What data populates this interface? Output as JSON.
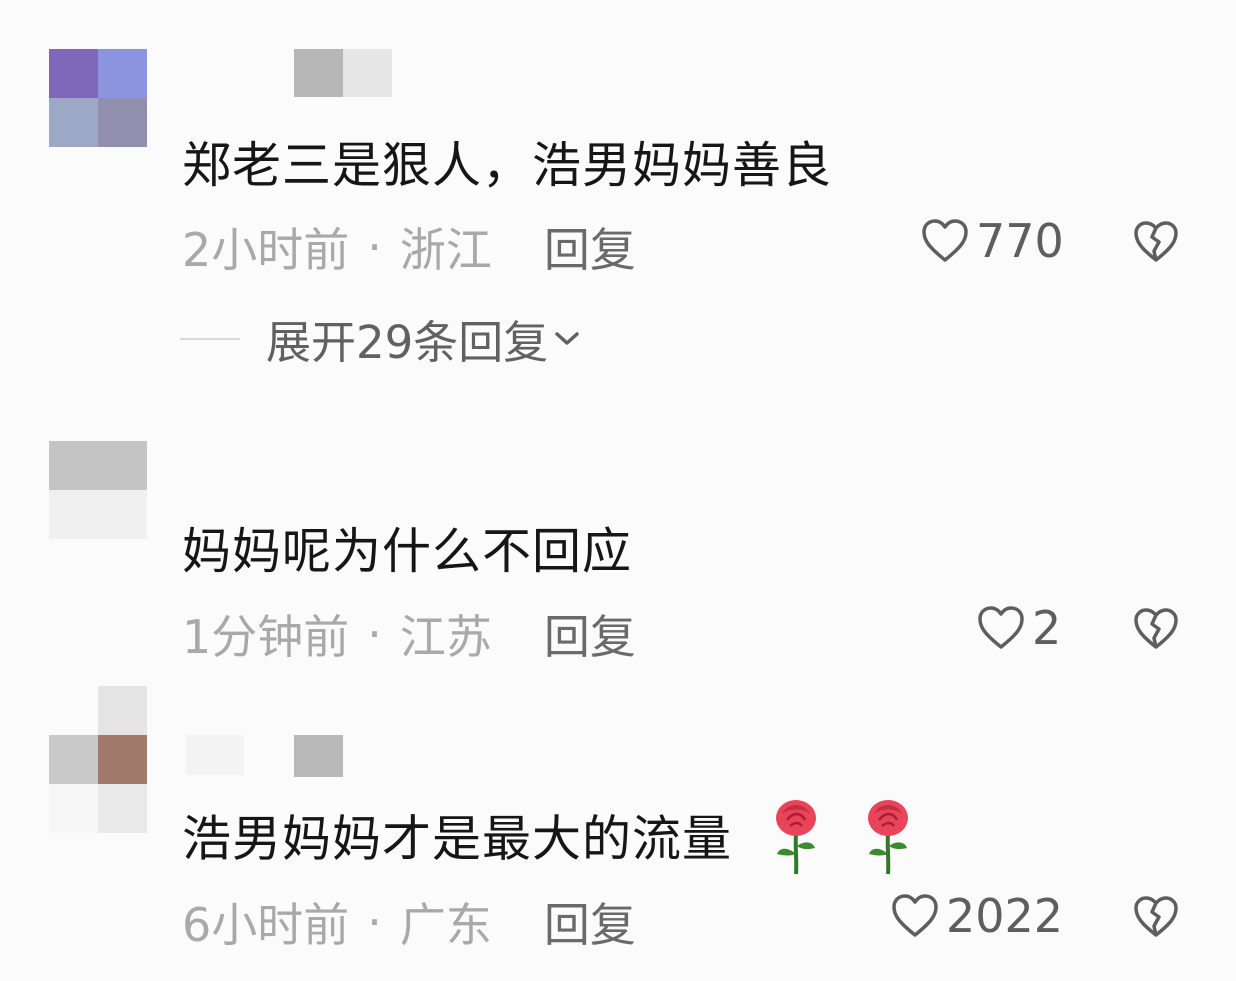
{
  "comments": [
    {
      "text": "郑老三是狠人，浩男妈妈善良",
      "time": "2小时前",
      "dot": "·",
      "location": "浙江",
      "reply": "回复",
      "likes": "770",
      "expand": "展开29条回复"
    },
    {
      "text": "妈妈呢为什么不回应",
      "time": "1分钟前",
      "dot": "·",
      "location": "江苏",
      "reply": "回复",
      "likes": "2"
    },
    {
      "text": "浩男妈妈才是最大的流量",
      "time": "6小时前",
      "dot": "·",
      "location": "广东",
      "reply": "回复",
      "likes": "2022",
      "emoji": [
        "rose-emoji",
        "rose-emoji"
      ]
    }
  ],
  "icons": {
    "like": "heart-outline-icon",
    "dislike": "broken-heart-icon",
    "expand": "chevron-down-icon"
  },
  "colors": {
    "text": "#161616",
    "meta": "#a9a9a9",
    "reply": "#6a6a6a"
  }
}
